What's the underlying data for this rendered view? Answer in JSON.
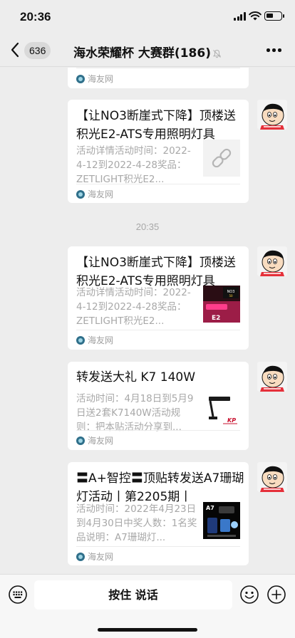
{
  "status_bar": {
    "time": "20:36"
  },
  "nav": {
    "back_count": "636",
    "title": "海水荣耀杯 大赛群(186)"
  },
  "messages": [
    {
      "source": "海友网"
    },
    {
      "title": "【让NO3断崖式下降】顶楼送积光E2-ATS专用照明灯具",
      "desc": "活动详情活动时间：2022-4-12到2022-4-28奖品：ZETLIGHT积光E2...",
      "thumb": "link-icon",
      "source": "海友网"
    },
    {
      "timestamp": "20:35"
    },
    {
      "title": "【让NO3断崖式下降】顶楼送积光E2-ATS专用照明灯具",
      "desc": "活动详情活动时间：2022-4-12到2022-4-28奖品：ZETLIGHT积光E2...",
      "thumb_text": "NO3去除 50不懂",
      "source": "海友网"
    },
    {
      "title": "转发送大礼 K7 140W",
      "desc": "活动时间：4月18日到5月9日送2套K7140W活动规则：把本贴活动分享到...",
      "source": "海友网"
    },
    {
      "title": "〓A+智控〓顶贴转发送A7珊瑚灯活动丨第2205期丨",
      "desc": "活动时间：2022年4月23日到4月30日中奖人数：1名奖品说明：A7珊瑚灯...",
      "thumb_text": "A7",
      "source": "海友网"
    }
  ],
  "input_bar": {
    "hold_to_talk": "按住 说话"
  },
  "colors": {
    "background": "#ededed",
    "bubble": "#ffffff",
    "muted_text": "#a8a8a8"
  }
}
